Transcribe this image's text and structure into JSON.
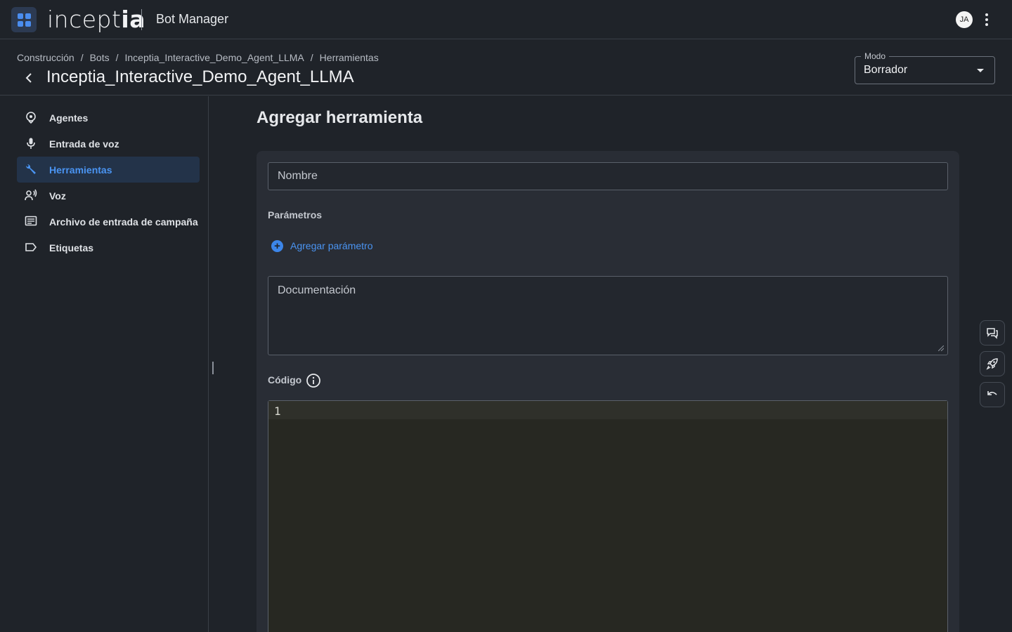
{
  "topbar": {
    "logo_light": "incept",
    "logo_bold": "ia",
    "product": "Bot Manager",
    "avatar_initials": "JA"
  },
  "header": {
    "breadcrumb": [
      "Construcción",
      "Bots",
      "Inceptia_Interactive_Demo_Agent_LLMA",
      "Herramientas"
    ],
    "title": "Inceptia_Interactive_Demo_Agent_LLMA",
    "mode": {
      "label": "Modo",
      "value": "Borrador"
    }
  },
  "sidebar": {
    "items": [
      {
        "label": "Agentes",
        "icon": "agent-icon",
        "active": false
      },
      {
        "label": "Entrada de voz",
        "icon": "microphone-icon",
        "active": false
      },
      {
        "label": "Herramientas",
        "icon": "wrench-icon",
        "active": true
      },
      {
        "label": "Voz",
        "icon": "voice-icon",
        "active": false
      },
      {
        "label": "Archivo de entrada de campaña",
        "icon": "document-icon",
        "active": false
      },
      {
        "label": "Etiquetas",
        "icon": "label-icon",
        "active": false
      }
    ]
  },
  "main": {
    "title": "Agregar herramienta",
    "name_placeholder": "Nombre",
    "params_label": "Parámetros",
    "add_param": "Agregar parámetro",
    "doc_placeholder": "Documentación",
    "code_label": "Código",
    "code_line_number": "1"
  },
  "colors": {
    "accent": "#4a94f2",
    "active_bg": "#233349",
    "background": "#1f2329",
    "card": "#292d35",
    "editor": "#272822"
  },
  "fabs": [
    "chat-icon",
    "rocket-icon",
    "undo-icon"
  ]
}
